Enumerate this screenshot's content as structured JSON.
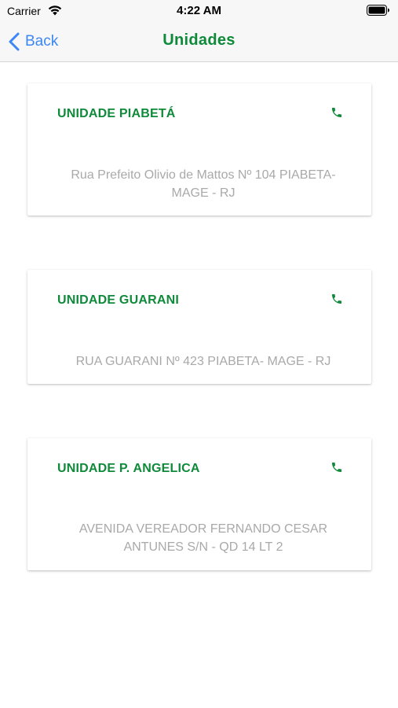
{
  "status": {
    "carrier": "Carrier",
    "time": "4:22 AM"
  },
  "nav": {
    "back_label": "Back",
    "title": "Unidades"
  },
  "colors": {
    "accent_green": "#0f8a3a",
    "ios_blue": "#3b87f5",
    "address_gray": "#a9a9a9"
  },
  "units": [
    {
      "name": "UNIDADE PIABETÁ",
      "address_line1": "Rua Prefeito Olivio de Mattos Nº 104 PIABETA-",
      "address_line2": "MAGE - RJ",
      "icon": "phone-icon"
    },
    {
      "name": "UNIDADE GUARANI",
      "address_line1": "RUA GUARANI Nº 423 PIABETA- MAGE - RJ",
      "address_line2": "",
      "icon": "phone-icon"
    },
    {
      "name": "UNIDADE P. ANGELICA",
      "address_line1": "AVENIDA VEREADOR FERNANDO CESAR",
      "address_line2": "ANTUNES S/N - QD 14 LT 2",
      "icon": "phone-icon"
    }
  ]
}
